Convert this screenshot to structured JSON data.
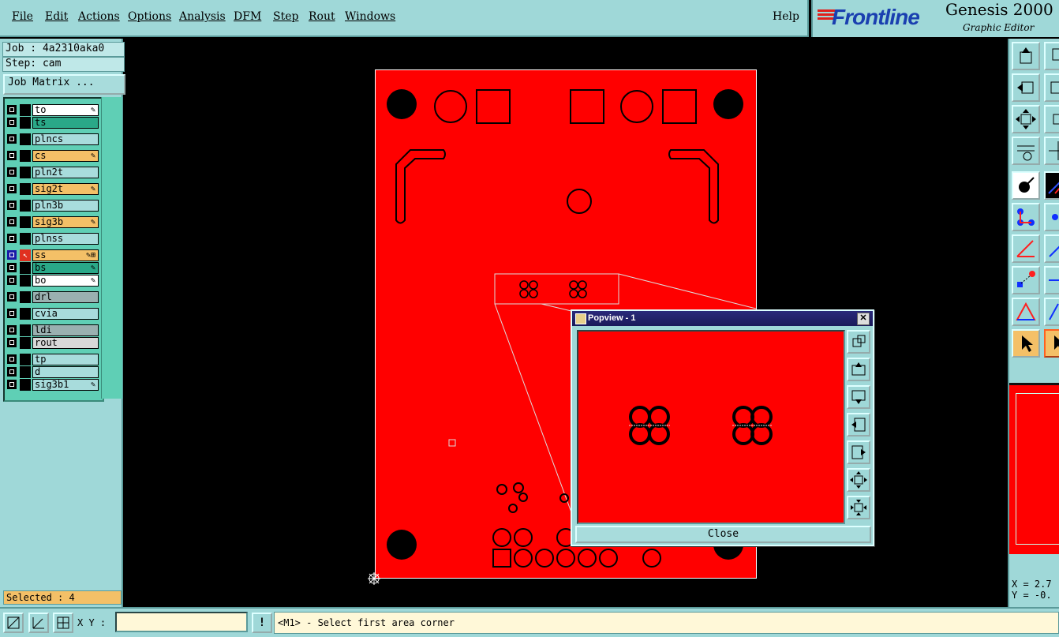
{
  "menu": {
    "items": [
      "File",
      "Edit",
      "Actions",
      "Options",
      "Analysis",
      "DFM",
      "Step",
      "Rout",
      "Windows"
    ],
    "help": "Help"
  },
  "branding": {
    "logo": "Frontline",
    "app_title": "Genesis 2000",
    "app_subtitle": "Graphic Editor"
  },
  "job": {
    "job_label": "Job : 4a2310aka0",
    "step_label": "Step: cam",
    "matrix_button": "Job Matrix ..."
  },
  "layers": [
    {
      "name": "to",
      "color": "#ffffff",
      "mark": "✎"
    },
    {
      "name": "ts",
      "color": "#2aa888",
      "mark": ""
    },
    {
      "name": "plncs",
      "color": "#a8dcdc",
      "mark": ""
    },
    {
      "name": "cs",
      "color": "#f4c067",
      "mark": "✎"
    },
    {
      "name": "pln2t",
      "color": "#a8dcdc",
      "mark": ""
    },
    {
      "name": "sig2t",
      "color": "#f4c067",
      "mark": "✎"
    },
    {
      "name": "pln3b",
      "color": "#a8dcdc",
      "mark": ""
    },
    {
      "name": "sig3b",
      "color": "#f4c067",
      "mark": "✎"
    },
    {
      "name": "plnss",
      "color": "#a8dcdc",
      "mark": ""
    },
    {
      "name": "ss",
      "color": "#f4c067",
      "mark": "✎⊞"
    },
    {
      "name": "bs",
      "color": "#2aa888",
      "mark": "✎"
    },
    {
      "name": "bo",
      "color": "#ffffff",
      "mark": "✎"
    },
    {
      "name": "drl",
      "color": "#9ab0b0",
      "mark": ""
    },
    {
      "name": "cvia",
      "color": "#a8dcdc",
      "mark": ""
    },
    {
      "name": "ldi",
      "color": "#9ab0b0",
      "mark": ""
    },
    {
      "name": "rout",
      "color": "#d8d8d8",
      "mark": ""
    },
    {
      "name": "tp",
      "color": "#a8dcdc",
      "mark": ""
    },
    {
      "name": "d",
      "color": "#a8dcdc",
      "mark": ""
    },
    {
      "name": "sig3b1",
      "color": "#a8dcdc",
      "mark": "✎"
    }
  ],
  "selected_text": "Selected : 4",
  "popview": {
    "title": "Popview - 1",
    "close_label": "Close"
  },
  "coords": {
    "x": "X = 2.7",
    "y": "Y = -0."
  },
  "bottom": {
    "xy_label": "X Y :",
    "xy_value": "",
    "status": "<M1> - Select first area corner",
    "msg_button": "!"
  },
  "colors": {
    "board": "#ff0000",
    "panel": "#9fd8d8",
    "active_layer": "#f4c067"
  }
}
